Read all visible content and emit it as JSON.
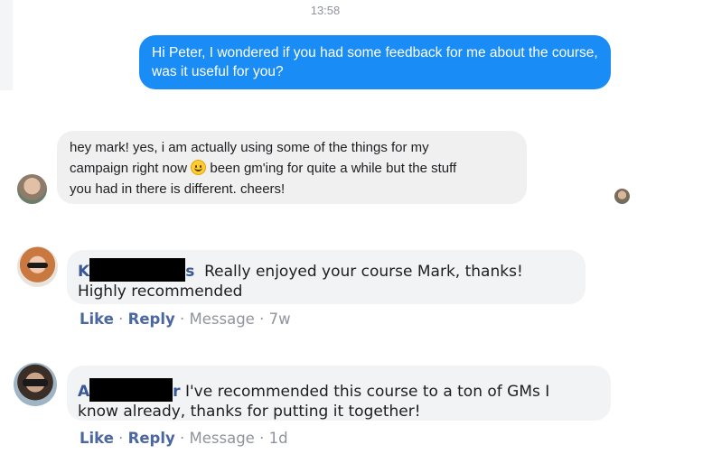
{
  "messenger": {
    "timestamp": "13:58",
    "outgoing": {
      "text": "Hi Peter, I wondered if you had some feedback for me about the course, was it useful for you?"
    },
    "incoming": {
      "line1": "hey mark! yes, i am actually using some of the things for my",
      "line2_before_emoji": "campaign right now ",
      "line2_after_emoji": " been gm'ing for quite a while but the stuff",
      "line3": "you had in there is different. cheers!",
      "emoji": "smiley-emoji"
    }
  },
  "comments": [
    {
      "name_visible_prefix": "K",
      "name_visible_suffix": "s",
      "text_line1": "Really enjoyed your course Mark, thanks!",
      "text_line2": "Highly recommended",
      "actions": {
        "like": "Like",
        "reply": "Reply",
        "message": "Message",
        "age": "7w"
      }
    },
    {
      "name_visible_prefix": "A",
      "name_visible_suffix": "r",
      "text_line1": "I've recommended this course to a ton of GMs I",
      "text_line2": "know already, thanks for putting it together!",
      "actions": {
        "like": "Like",
        "reply": "Reply",
        "message": "Message",
        "age": "1d"
      }
    }
  ],
  "separator": " · ",
  "colors": {
    "outgoing_bubble": "#1a8cf5",
    "incoming_bubble": "#f1f0f0",
    "comment_bubble": "#f2f3f5",
    "action_link": "#4b67a1",
    "meta_text": "#90949c"
  }
}
